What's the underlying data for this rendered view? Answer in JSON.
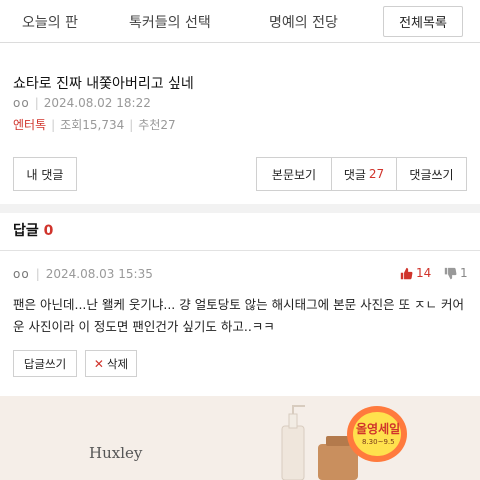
{
  "nav": {
    "tabs": [
      "오늘의 판",
      "톡커들의 선택",
      "명예의 전당"
    ],
    "all_button": "전체목록"
  },
  "post": {
    "title": "쇼타로 진짜 내쫓아버리고 싶네",
    "author_icon": "oo",
    "date": "2024.08.02 18:22",
    "category": "엔터톡",
    "views_label": "조회15,734",
    "recommend_label": "추천27"
  },
  "actions": {
    "my_comments": "내 댓글",
    "view_body": "본문보기",
    "comments_label": "댓글",
    "comments_count": "27",
    "write_comment": "댓글쓰기"
  },
  "replies": {
    "label": "답글",
    "count": "0"
  },
  "comment": {
    "author_icon": "oo",
    "date": "2024.08.03 15:35",
    "upvotes": "14",
    "downvotes": "1",
    "text": "팬은 아닌데...난 왤케 웃기냐... 걍 얼토당토 않는 해시태그에 본문 사진은 또 ㅈㄴ 커어운 사진이라 이 정도면 팬인건가 싶기도 하고..ㅋㅋ",
    "reply_button": "답글쓰기",
    "delete_button": "삭제"
  },
  "ad": {
    "brand": "Huxley",
    "badge_text": "올영세일",
    "badge_sub": "8.30~9.5"
  },
  "colors": {
    "accent": "#d0342c",
    "ad_bg": "#f5eee8"
  }
}
